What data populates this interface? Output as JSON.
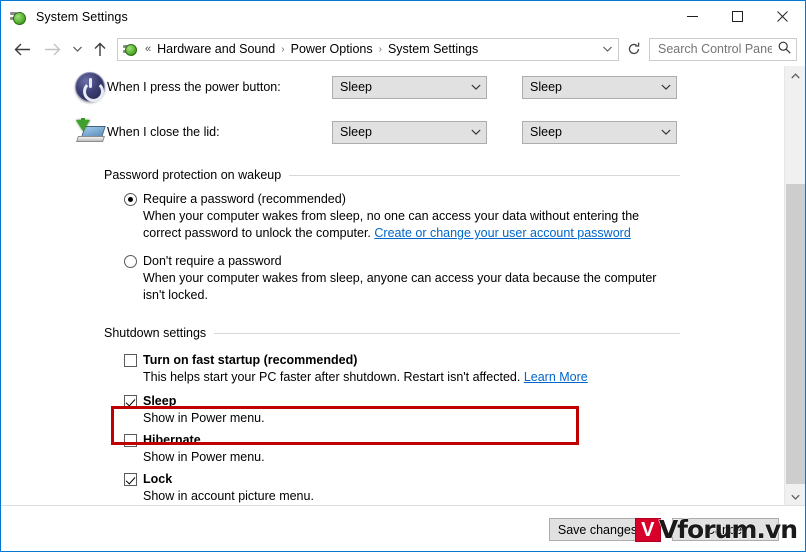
{
  "window": {
    "title": "System Settings",
    "title_icon": "power-plug-icon",
    "controls": {
      "minimize": "—",
      "maximize": "☐",
      "close": "✕"
    }
  },
  "nav": {
    "back": "←",
    "forward": "→",
    "history": "⌄",
    "up": "↑",
    "refresh": "↻",
    "breadcrumb_icon": "power-plug-icon",
    "breadcrumb_overflow": "«",
    "breadcrumb": [
      "Hardware and Sound",
      "Power Options",
      "System Settings"
    ],
    "breadcrumb_separator": "›",
    "breadcrumb_dropdown": "⌄"
  },
  "search": {
    "placeholder": "Search Control Panel",
    "value": "",
    "icon": "search-icon"
  },
  "settings_rows": [
    {
      "icon": "power-button-icon",
      "label": "When I press the power button:",
      "battery_value": "Sleep",
      "plugged_value": "Sleep"
    },
    {
      "icon": "laptop-lid-icon",
      "label": "When I close the lid:",
      "battery_value": "Sleep",
      "plugged_value": "Sleep"
    }
  ],
  "password_section": {
    "heading": "Password protection on wakeup",
    "options": [
      {
        "title": "Require a password (recommended)",
        "checked": true,
        "desc_before": "When your computer wakes from sleep, no one can access your data without entering the correct password to unlock the computer. ",
        "link": "Create or change your user account password"
      },
      {
        "title": "Don't require a password",
        "checked": false,
        "desc_before": "When your computer wakes from sleep, anyone can access your data because the computer isn't locked.",
        "link": ""
      }
    ]
  },
  "shutdown_section": {
    "heading": "Shutdown settings",
    "items": [
      {
        "title": "Turn on fast startup (recommended)",
        "checked": false,
        "desc_before": "This helps start your PC faster after shutdown. Restart isn't affected. ",
        "link": "Learn More",
        "highlighted": true
      },
      {
        "title": "Sleep",
        "checked": true,
        "desc_before": "Show in Power menu.",
        "link": "",
        "highlighted": false
      },
      {
        "title": "Hibernate",
        "checked": false,
        "desc_before": "Show in Power menu.",
        "link": "",
        "highlighted": false
      },
      {
        "title": "Lock",
        "checked": true,
        "desc_before": "Show in account picture menu.",
        "link": "",
        "highlighted": false
      }
    ]
  },
  "footer": {
    "save_label": "Save changes",
    "cancel_label": "Cancel"
  },
  "watermark": {
    "badge": "V",
    "text": "Vforum.vn"
  },
  "scrollbar": {
    "up_arrow": "∧",
    "down_arrow": "∨"
  },
  "colors": {
    "accent": "#0078d7",
    "highlight_box": "#c00000",
    "link": "#0066cc",
    "button_face": "#e1e1e1"
  }
}
